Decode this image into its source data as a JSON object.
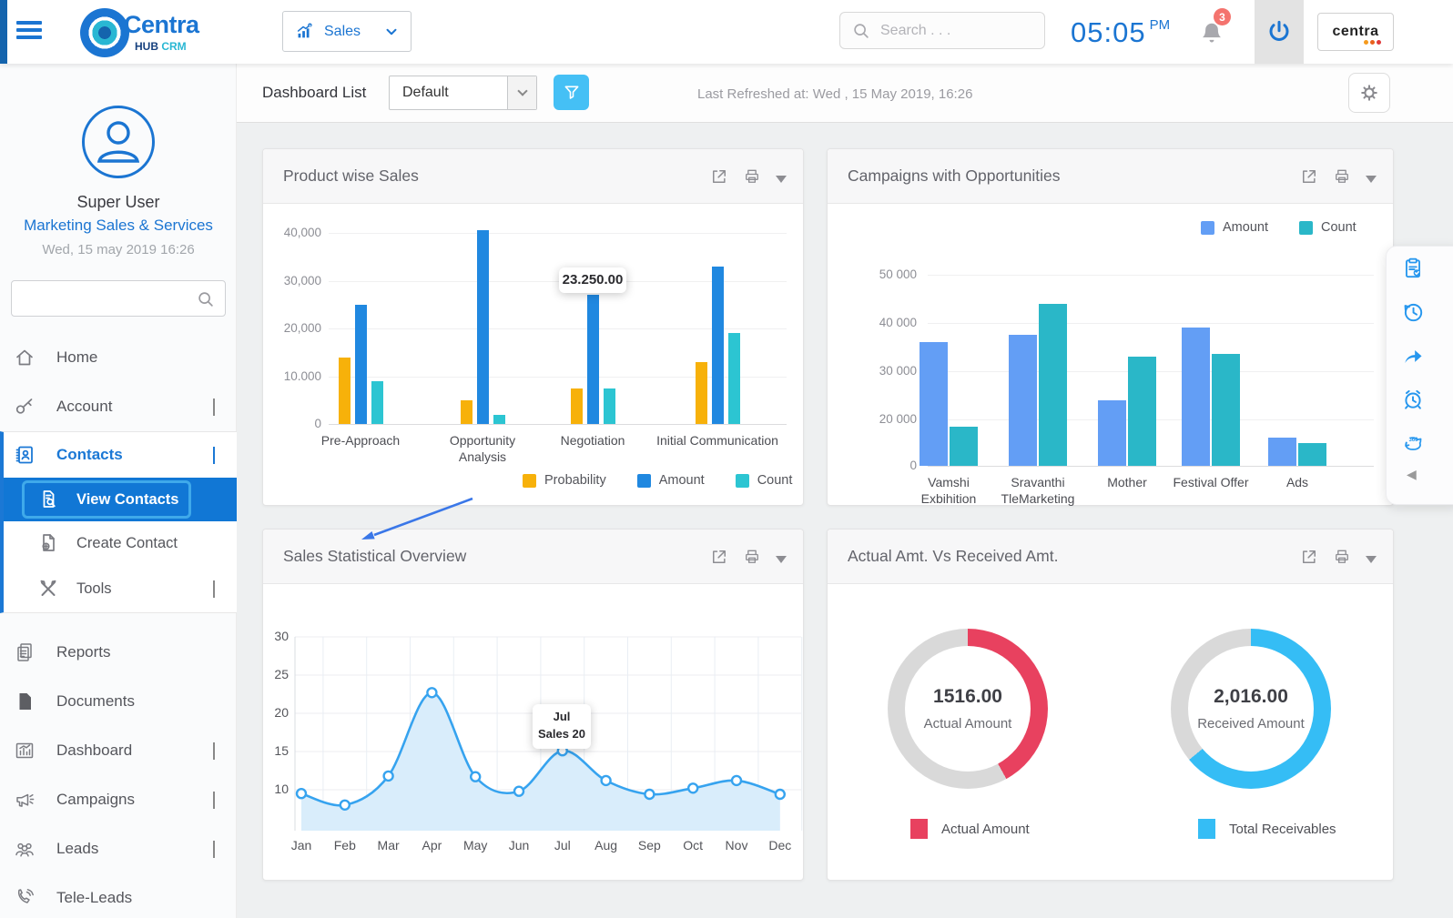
{
  "topbar": {
    "brand": {
      "name": "Centra",
      "sub_primary": "HUB",
      "sub_secondary": "CRM"
    },
    "module_select": {
      "label": "Sales"
    },
    "search": {
      "placeholder": "Search . . ."
    },
    "clock": {
      "time": "05:05",
      "meridiem": "PM"
    },
    "notifications": {
      "count": "3"
    },
    "brand_badge": "centra"
  },
  "toolbar": {
    "title": "Dashboard List",
    "view_select": {
      "value": "Default"
    },
    "last_refreshed": "Last Refreshed at: Wed , 15 May 2019, 16:26"
  },
  "sidebar": {
    "user": {
      "name": "Super User",
      "org": "Marketing Sales & Services",
      "datetime": "Wed, 15 may 2019 16:26"
    },
    "search": {
      "placeholder": ""
    },
    "items": [
      {
        "id": "home",
        "label": "Home",
        "icon": "home"
      },
      {
        "id": "account",
        "label": "Account",
        "icon": "key",
        "chevron": "down"
      },
      {
        "id": "contacts",
        "label": "Contacts",
        "icon": "contacts",
        "chevron": "up",
        "state": "active-parent"
      },
      {
        "id": "view-contacts",
        "label": "View Contacts",
        "icon": "view-contacts",
        "sub": true,
        "state": "selected"
      },
      {
        "id": "create-contact",
        "label": "Create Contact",
        "icon": "create-contact",
        "sub": true
      },
      {
        "id": "tools",
        "label": "Tools",
        "icon": "tools",
        "sub": true,
        "chevron": "down"
      },
      {
        "id": "reports",
        "label": "Reports",
        "icon": "reports"
      },
      {
        "id": "documents",
        "label": "Documents",
        "icon": "documents"
      },
      {
        "id": "dashboard",
        "label": "Dashboard",
        "icon": "dashboard",
        "chevron": "down"
      },
      {
        "id": "campaigns",
        "label": "Campaigns",
        "icon": "campaigns",
        "chevron": "down"
      },
      {
        "id": "leads",
        "label": "Leads",
        "icon": "leads",
        "chevron": "down"
      },
      {
        "id": "tele-leads",
        "label": "Tele-Leads",
        "icon": "tele-leads"
      }
    ]
  },
  "cards": [
    {
      "title": "Product wise Sales"
    },
    {
      "title": "Campaigns with Opportunities"
    },
    {
      "title": "Sales Statistical Overview"
    },
    {
      "title": "Actual Amt. Vs Received Amt."
    }
  ],
  "chart_data": [
    {
      "type": "bar",
      "title": "Product wise Sales",
      "categories": [
        "Pre-Approach",
        "Opportunity Analysis",
        "Negotiation",
        "Initial Communication"
      ],
      "series": [
        {
          "name": "Probability",
          "color": "#f7b10a",
          "values": [
            14000,
            5000,
            7500,
            13000
          ]
        },
        {
          "name": "Amount",
          "color": "#2088e0",
          "values": [
            25000,
            40500,
            27000,
            33000
          ]
        },
        {
          "name": "Count",
          "color": "#2cc5d2",
          "values": [
            9000,
            2000,
            7500,
            19000
          ]
        }
      ],
      "y_ticks": [
        {
          "label": "40,000",
          "value": 40000
        },
        {
          "label": "30,000",
          "value": 30000
        },
        {
          "label": "20,000",
          "value": 20000
        },
        {
          "label": "10.000",
          "value": 10000
        },
        {
          "label": "0",
          "value": 0
        }
      ],
      "ylim": [
        0,
        42000
      ],
      "grid": true,
      "legend_position": "bottom",
      "tooltip": {
        "text": "23.250.00",
        "category": "Negotiation",
        "series": "Amount"
      }
    },
    {
      "type": "bar",
      "title": "Campaigns with Opportunities",
      "categories": [
        "Vamshi Exbihition",
        "Sravanthi TleMarketing",
        "Mother",
        "Festival Offer",
        "Ads"
      ],
      "series": [
        {
          "name": "Amount",
          "color": "#639ef5",
          "values": [
            36000,
            37500,
            24000,
            39000,
            12000
          ]
        },
        {
          "name": "Count",
          "color": "#2ab7c8",
          "values": [
            17000,
            44000,
            33000,
            33500,
            10000
          ]
        }
      ],
      "y_ticks": [
        {
          "label": "50 000",
          "value": 50000
        },
        {
          "label": "40 000",
          "value": 40000
        },
        {
          "label": "30 000",
          "value": 30000
        },
        {
          "label": "20 000",
          "value": 20000
        },
        {
          "label": "0",
          "value": 0
        }
      ],
      "ylim": [
        0,
        50000
      ],
      "grid": true,
      "legend_position": "top-right"
    },
    {
      "type": "area",
      "title": "Sales Statistical Overview",
      "x": [
        "Jan",
        "Feb",
        "Mar",
        "Apr",
        "May",
        "Jun",
        "Jul",
        "Aug",
        "Sep",
        "Oct",
        "Nov",
        "Dec"
      ],
      "values": [
        9.5,
        8,
        11.8,
        22.7,
        11.7,
        9.8,
        15.1,
        11.2,
        9.4,
        10.2,
        11.2,
        9.4
      ],
      "y_ticks": [
        30,
        25,
        20,
        15,
        10
      ],
      "ylim": [
        5,
        30
      ],
      "grid": true,
      "line_color": "#36a3ef",
      "fill_color": "#d9edfb",
      "tooltip": {
        "lines": [
          "Jul",
          "Sales 20"
        ],
        "x": "Jul"
      }
    },
    {
      "type": "donut-pair",
      "title": "Actual Amt. Vs Received Amt.",
      "track_color": "#d9d9d9",
      "donuts": [
        {
          "value": "1516.00",
          "label": "Actual Amount",
          "fraction": 0.42,
          "color": "#e8415f",
          "legend": "Actual Amount"
        },
        {
          "value": "2,016.00",
          "label": "Received Amount",
          "fraction": 0.64,
          "color": "#35bdf5",
          "legend": "Total Receivables"
        }
      ]
    }
  ],
  "right_panel": {
    "icons": [
      {
        "name": "tasks-clipboard"
      },
      {
        "name": "history-clock"
      },
      {
        "name": "share-arrow"
      },
      {
        "name": "alarm-clock"
      },
      {
        "name": "sync-360"
      }
    ],
    "collapse_glyph": "◀"
  }
}
